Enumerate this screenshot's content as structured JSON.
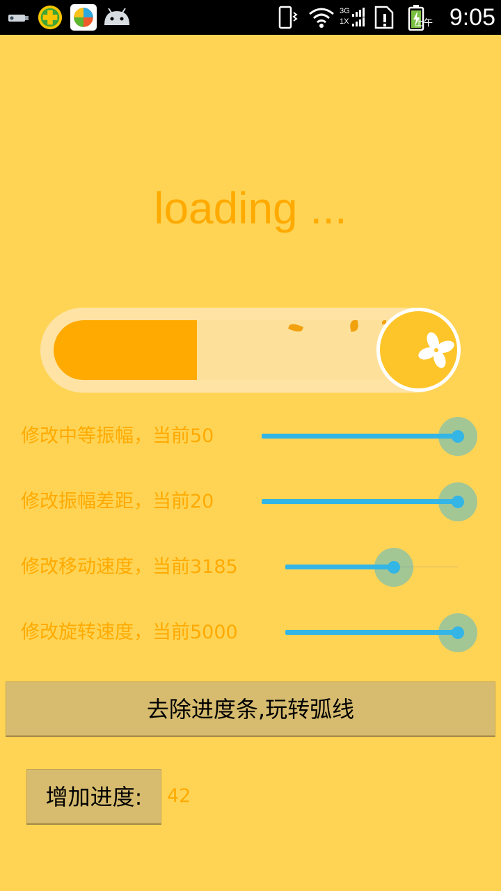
{
  "status_bar": {
    "time": "9:05",
    "ampm": "上午",
    "network": "3G",
    "network2": "1X",
    "icons": [
      "usb-icon",
      "app-plus-icon",
      "app-store-icon",
      "android-icon",
      "vibrate-icon",
      "wifi-icon",
      "signal-icon",
      "sim-alert-icon",
      "battery-charging-icon"
    ]
  },
  "loading_text": "loading ...",
  "progress": {
    "value": 42,
    "max": 100
  },
  "sliders": [
    {
      "label": "修改中等振幅，当前50",
      "value": 1.0
    },
    {
      "label": "修改振幅差距，当前20",
      "value": 1.0
    },
    {
      "label": "修改移动速度，当前3185",
      "value": 0.63
    },
    {
      "label": "修改旋转速度，当前5000",
      "value": 1.0
    }
  ],
  "buttons": {
    "remove_progress": "去除进度条,玩转弧线",
    "add_progress": "增加进度:"
  },
  "progress_display": "42",
  "colors": {
    "background": "#FFD455",
    "accent": "#FFAA00",
    "slider": "#33B5E5",
    "button": "#D7BC70"
  }
}
